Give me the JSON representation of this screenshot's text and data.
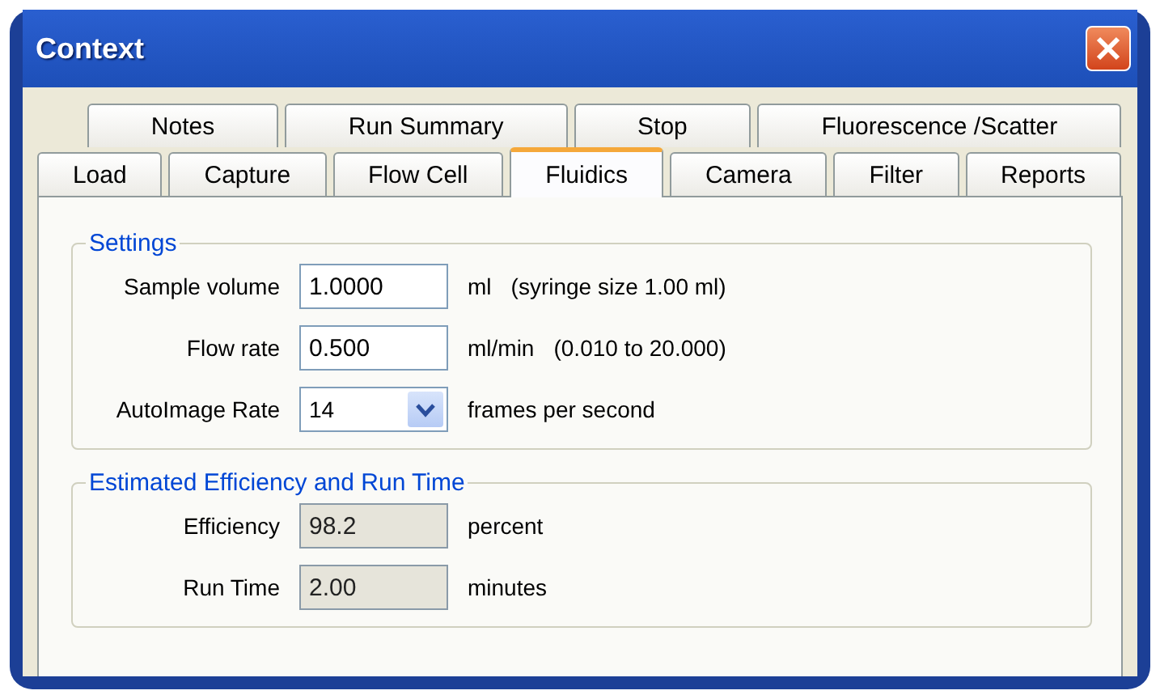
{
  "window": {
    "title": "Context"
  },
  "tab_rows": [
    {
      "tabs": [
        {
          "label": "Notes",
          "selected": false
        },
        {
          "label": "Run Summary",
          "selected": false
        },
        {
          "label": "Stop",
          "selected": false
        },
        {
          "label": "Fluorescence /Scatter",
          "selected": false
        }
      ]
    },
    {
      "tabs": [
        {
          "label": "Load",
          "selected": false
        },
        {
          "label": "Capture",
          "selected": false
        },
        {
          "label": "Flow Cell",
          "selected": false
        },
        {
          "label": "Fluidics",
          "selected": true
        },
        {
          "label": "Camera",
          "selected": false
        },
        {
          "label": "Filter",
          "selected": false
        },
        {
          "label": "Reports",
          "selected": false
        }
      ]
    }
  ],
  "groups": [
    {
      "title": "Settings",
      "rows": [
        {
          "label": "Sample volume",
          "kind": "text",
          "value": "1.0000",
          "readonly": false,
          "unit": "ml",
          "note": "(syringe size 1.00 ml)"
        },
        {
          "label": "Flow rate",
          "kind": "text",
          "value": "0.500",
          "readonly": false,
          "unit": "ml/min",
          "note": "(0.010  to  20.000)"
        },
        {
          "label": "AutoImage Rate",
          "kind": "dropdown",
          "value": "14",
          "unit": "frames per second"
        }
      ]
    },
    {
      "title": "Estimated Efficiency and Run Time",
      "rows": [
        {
          "label": "Efficiency",
          "kind": "text",
          "value": "98.2",
          "readonly": true,
          "unit": "percent"
        },
        {
          "label": "Run Time",
          "kind": "text",
          "value": "2.00",
          "readonly": true,
          "unit": "minutes"
        }
      ]
    }
  ]
}
